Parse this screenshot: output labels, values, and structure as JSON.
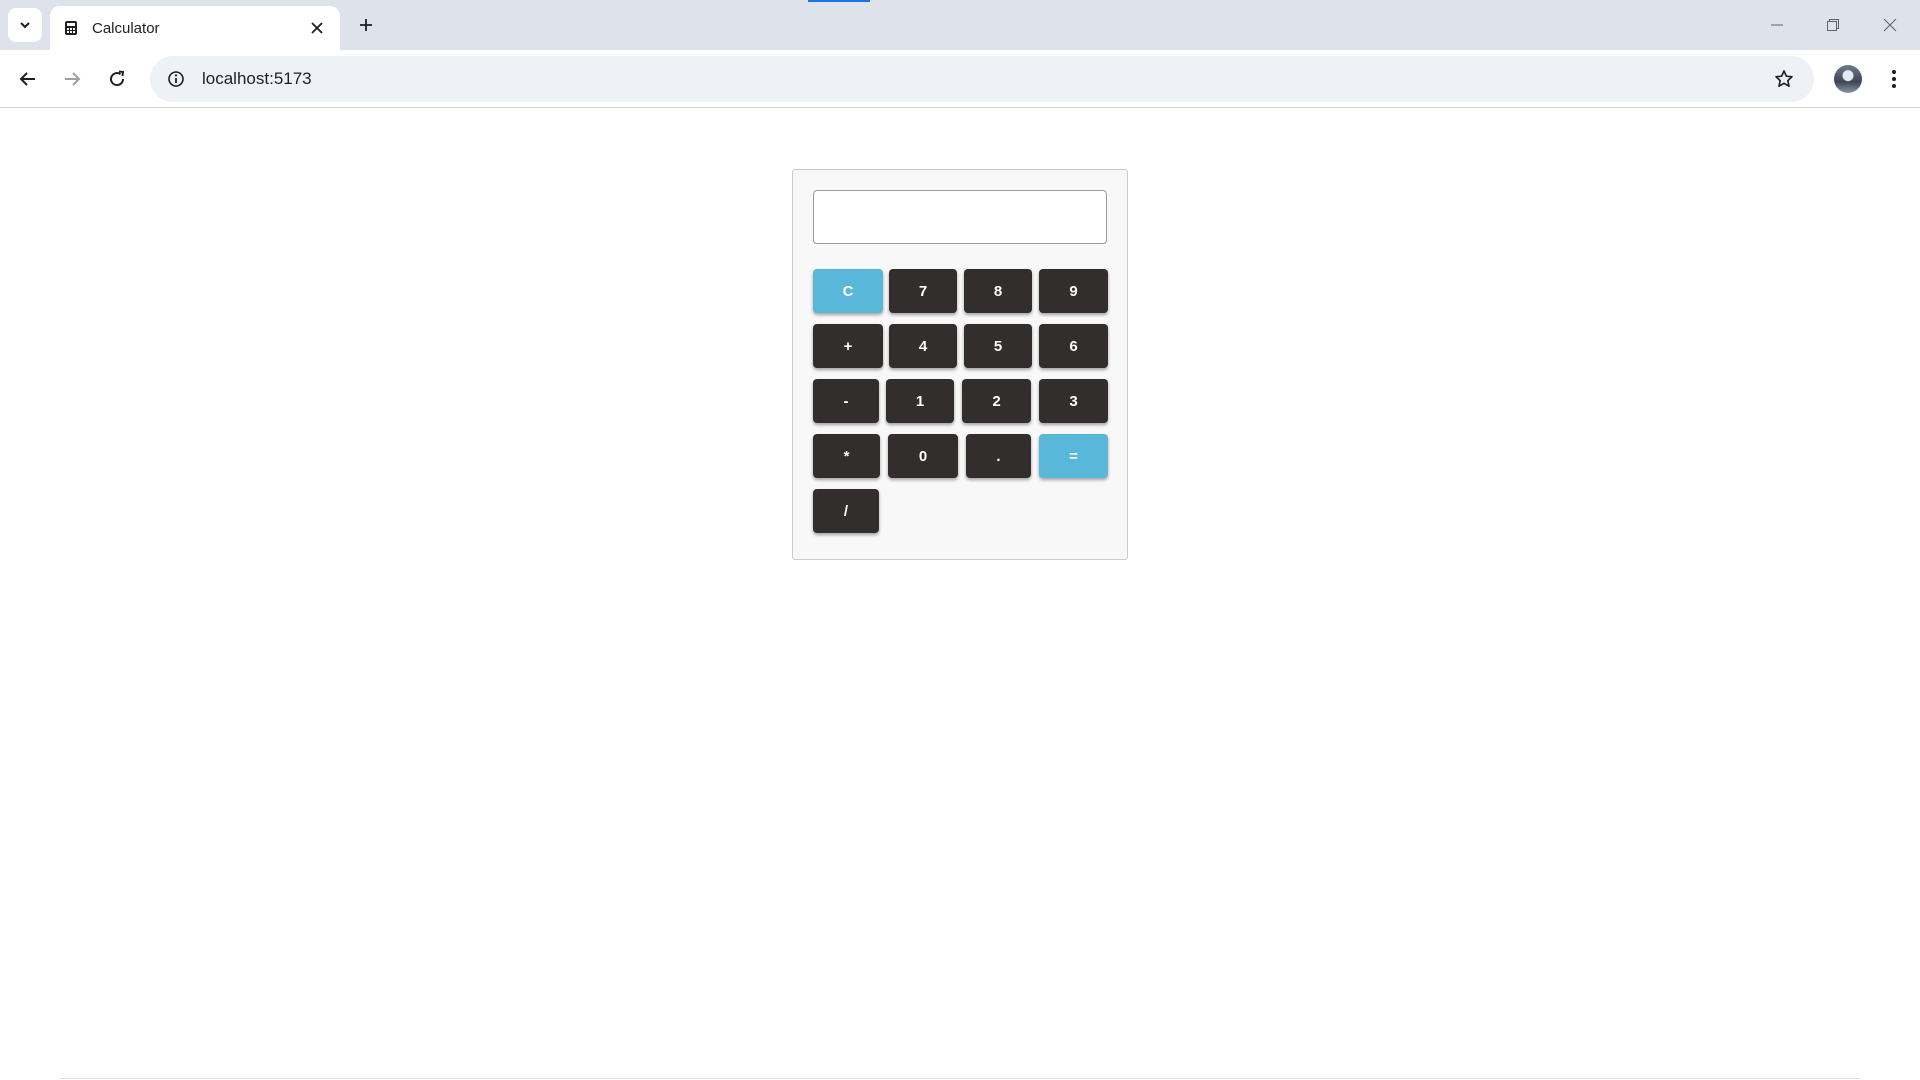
{
  "browser": {
    "tab_title": "Calculator",
    "url": "localhost:5173",
    "icons": {
      "tab_search": "chevron-down-icon",
      "favicon": "calculator-icon",
      "tab_close": "close-icon",
      "new_tab": "plus-icon",
      "back": "arrow-left-icon",
      "forward": "arrow-right-icon",
      "reload": "reload-icon",
      "site_info": "info-icon",
      "bookmark": "star-icon",
      "menu": "kebab-menu-icon"
    }
  },
  "calculator": {
    "display_value": "",
    "colors": {
      "key": "#332e2e",
      "accent": "#59b8da"
    },
    "keys": {
      "clear": "C",
      "seven": "7",
      "eight": "8",
      "nine": "9",
      "plus": "+",
      "four": "4",
      "five": "5",
      "six": "6",
      "minus": "-",
      "one": "1",
      "two": "2",
      "three": "3",
      "multiply": "*",
      "zero": "0",
      "decimal": ".",
      "equals": "=",
      "divide": "/"
    }
  }
}
